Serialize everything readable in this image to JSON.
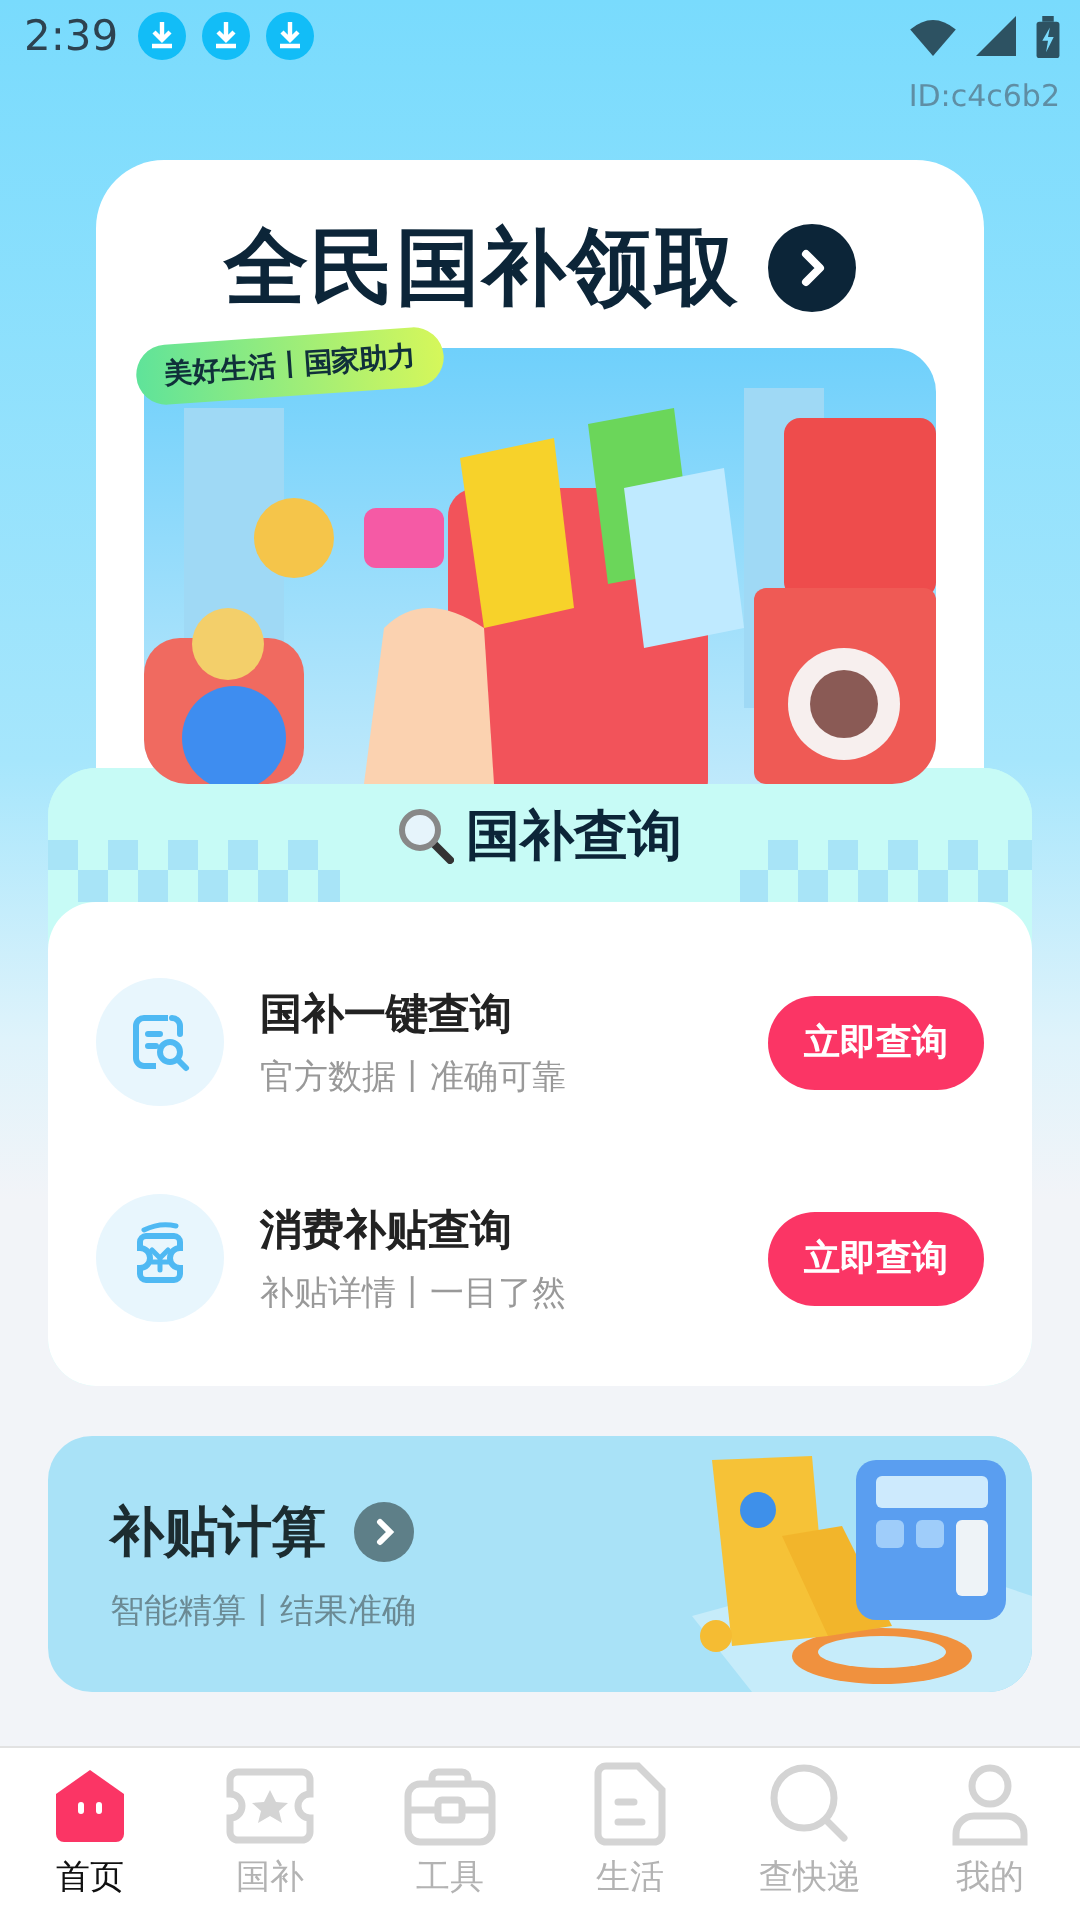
{
  "status_bar": {
    "time": "2:39"
  },
  "id_label": "ID:c4c6b2",
  "promo_card": {
    "title": "全民国补领取",
    "tag": "美好生活丨国家助力"
  },
  "query_section": {
    "title": "国补查询",
    "items": [
      {
        "title": "国补一键查询",
        "subtitle": "官方数据丨准确可靠",
        "button": "立即查询"
      },
      {
        "title": "消费补贴查询",
        "subtitle": "补贴详情丨一目了然",
        "button": "立即查询"
      }
    ]
  },
  "calc_card": {
    "title": "补贴计算",
    "subtitle": "智能精算丨结果准确"
  },
  "tab_bar": [
    {
      "label": "首页",
      "selected": true
    },
    {
      "label": "国补",
      "selected": false
    },
    {
      "label": "工具",
      "selected": false
    },
    {
      "label": "生活",
      "selected": false
    },
    {
      "label": "查快递",
      "selected": false
    },
    {
      "label": "我的",
      "selected": false
    }
  ]
}
